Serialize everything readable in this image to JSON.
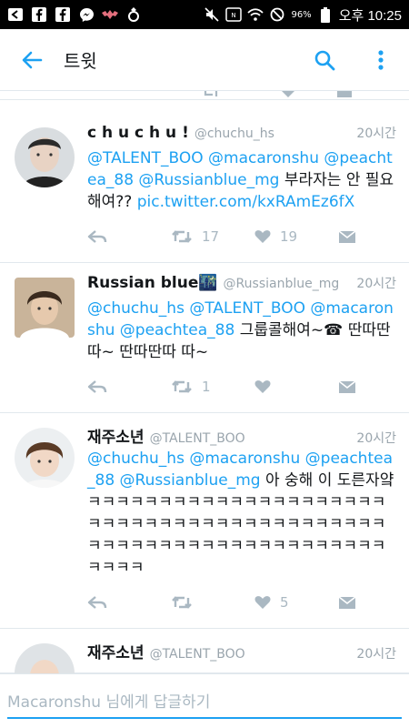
{
  "status_bar": {
    "battery": "96%",
    "time": "오후 10:25"
  },
  "app_bar": {
    "title": "트윗",
    "back_icon": "arrow-left-icon",
    "search_icon": "search-icon",
    "more_icon": "more-vertical-icon"
  },
  "tweets": [
    {
      "name": "c h u c h u !",
      "handle": "@chuchu_hs",
      "time": "20시간",
      "mentions": "@TALENT_BOO @macaronshu @peachtea_88 @Russianblue_mg",
      "text": "부라자는 안 필요해여??",
      "link": "pic.twitter.com/kxRAmEz6fX",
      "retweets": "17",
      "likes": "19"
    },
    {
      "name": "Russian blue🌃",
      "handle": "@Russianblue_mg",
      "time": "20시간",
      "mentions": "@chuchu_hs @TALENT_BOO @macaronshu @peachtea_88",
      "text": "그룹콜해여~☎ 딴따딴따~ 딴따딴따 따~",
      "retweets": "1",
      "likes": ""
    },
    {
      "name": "재주소년",
      "handle": "@TALENT_BOO",
      "time": "20시간",
      "mentions": "@chuchu_hs @macaronshu @peachtea_88 @Russianblue_mg",
      "text": "아 숭해 이 도른자얔ㅋㅋㅋㅋㅋㅋㅋㅋㅋㅋㅋㅋㅋㅋㅋㅋㅋㅋㅋㅋㅋㅋㅋㅋㅋㅋㅋㅋㅋㅋㅋㅋㅋㅋㅋㅋㅋㅋㅋㅋㅋㅋㅋㅋㅋㅋㅋㅋㅋㅋㅋㅋㅋㅋㅋㅋㅋㅋㅋㅋㅋㅋㅋㅋㅋㅋㅋ",
      "retweets": "",
      "likes": "5"
    },
    {
      "name": "재주소년",
      "handle": "@TALENT_BOO",
      "time": "20시간"
    }
  ],
  "reply_bar": {
    "placeholder": "Macaronshu 님에게 답글하기"
  },
  "colors": {
    "accent": "#1da1f2",
    "muted": "#aab8c2",
    "divider": "#e1e8ed"
  }
}
